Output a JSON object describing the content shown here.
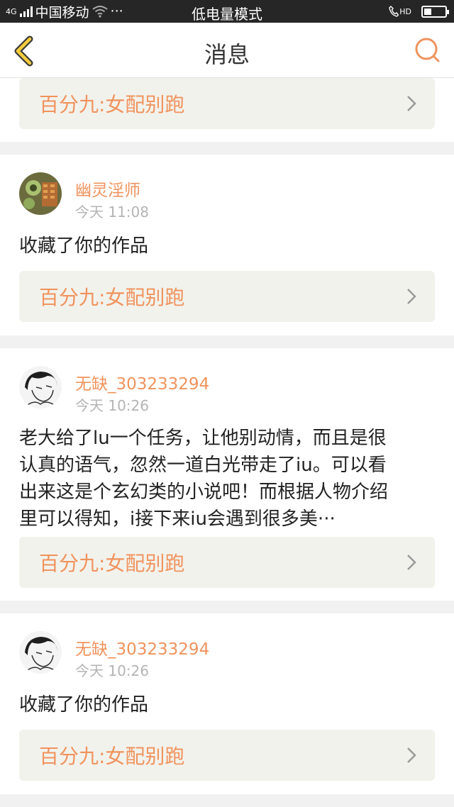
{
  "status_bar": {
    "network": "4G",
    "carrier": "中国移动",
    "more": "···",
    "mode": "低电量模式",
    "hd": "HD",
    "battery_level": 0.35
  },
  "header": {
    "title": "消息",
    "back_icon": "chevron-left-icon",
    "search_icon": "search-icon"
  },
  "colors": {
    "accent": "#f0935d",
    "back_icon": "#f4cd3c",
    "card_bg": "#ffffff",
    "work_box_bg": "#f2f2ec"
  },
  "messages": [
    {
      "work_title": "百分九:女配别跑"
    },
    {
      "username": "幽灵淫师",
      "time": "今天 11:08",
      "content": "收藏了你的作品",
      "work_title": "百分九:女配别跑"
    },
    {
      "username": "无缺_303233294",
      "time": "今天 10:26",
      "content_lines": [
        "老大给了lu一个任务，让他别动情，而且是很",
        "认真的语气，忽然一道白光带走了iu。可以看",
        "出来这是个玄幻类的小说吧！而根据人物介绍",
        "里可以得知，i接下来iu会遇到很多美···"
      ],
      "work_title": "百分九:女配别跑"
    },
    {
      "username": "无缺_303233294",
      "time": "今天 10:26",
      "content": "收藏了你的作品",
      "work_title": "百分九:女配别跑"
    }
  ]
}
